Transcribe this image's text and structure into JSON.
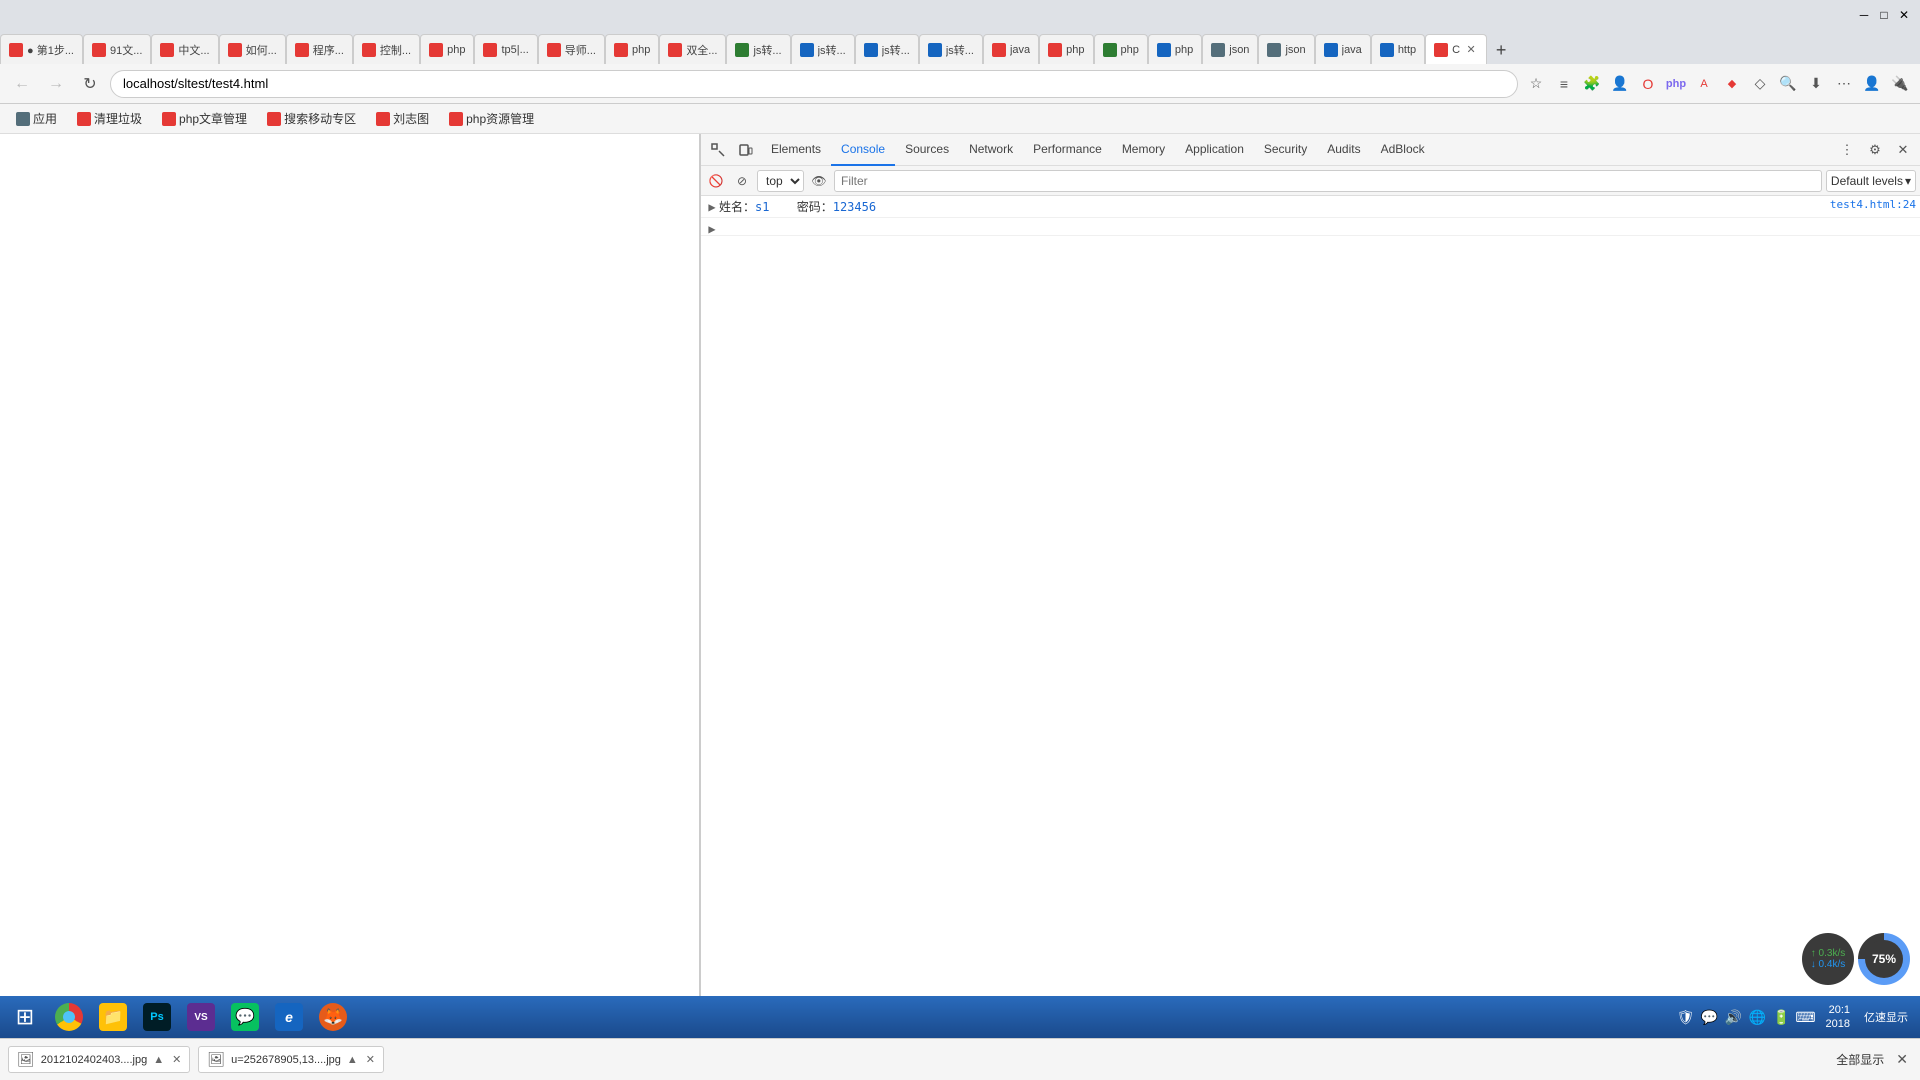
{
  "titleBar": {
    "minimizeLabel": "─",
    "maximizeLabel": "□",
    "closeLabel": "✕"
  },
  "tabs": [
    {
      "id": "tab-1",
      "favicon": "red",
      "label": "● 第1步..."
    },
    {
      "id": "tab-2",
      "favicon": "red",
      "label": "91文..."
    },
    {
      "id": "tab-3",
      "favicon": "red",
      "label": "中文..."
    },
    {
      "id": "tab-4",
      "favicon": "red",
      "label": "如何..."
    },
    {
      "id": "tab-5",
      "favicon": "red",
      "label": "程序..."
    },
    {
      "id": "tab-6",
      "favicon": "red",
      "label": "控制..."
    },
    {
      "id": "tab-7",
      "favicon": "red",
      "label": "php"
    },
    {
      "id": "tab-8",
      "favicon": "red",
      "label": "tp5|..."
    },
    {
      "id": "tab-9",
      "favicon": "red",
      "label": "导师..."
    },
    {
      "id": "tab-10",
      "favicon": "red",
      "label": "php"
    },
    {
      "id": "tab-11",
      "favicon": "red",
      "label": "双全..."
    },
    {
      "id": "tab-12",
      "favicon": "green",
      "label": "js转..."
    },
    {
      "id": "tab-13",
      "favicon": "blue",
      "label": "js转..."
    },
    {
      "id": "tab-14",
      "favicon": "blue",
      "label": "js转..."
    },
    {
      "id": "tab-15",
      "favicon": "blue",
      "label": "js转..."
    },
    {
      "id": "tab-16",
      "favicon": "red",
      "label": "java"
    },
    {
      "id": "tab-17",
      "favicon": "red",
      "label": "php"
    },
    {
      "id": "tab-18",
      "favicon": "green",
      "label": "php"
    },
    {
      "id": "tab-19",
      "favicon": "blue",
      "label": "php"
    },
    {
      "id": "tab-20",
      "favicon": "gray",
      "label": "json"
    },
    {
      "id": "tab-21",
      "favicon": "gray",
      "label": "json"
    },
    {
      "id": "tab-22",
      "favicon": "blue",
      "label": "java"
    },
    {
      "id": "tab-23",
      "favicon": "blue",
      "label": "http"
    },
    {
      "id": "tab-24",
      "favicon": "red",
      "label": "C",
      "active": true,
      "hasClose": true
    }
  ],
  "addressBar": {
    "url": "localhost/sltest/test4.html",
    "backEnabled": false,
    "forwardEnabled": false
  },
  "bookmarks": [
    {
      "label": "应用",
      "favicon": "gray"
    },
    {
      "label": "清理垃圾",
      "favicon": "red"
    },
    {
      "label": "php文章管理",
      "favicon": "red"
    },
    {
      "label": "搜索移动专区",
      "favicon": "red"
    },
    {
      "label": "刘志图",
      "favicon": "red"
    },
    {
      "label": "php资源管理",
      "favicon": "red"
    }
  ],
  "devtools": {
    "tabs": [
      {
        "label": "Elements",
        "active": false
      },
      {
        "label": "Console",
        "active": true
      },
      {
        "label": "Sources",
        "active": false
      },
      {
        "label": "Network",
        "active": false
      },
      {
        "label": "Performance",
        "active": false
      },
      {
        "label": "Memory",
        "active": false
      },
      {
        "label": "Application",
        "active": false
      },
      {
        "label": "Security",
        "active": false
      },
      {
        "label": "Audits",
        "active": false
      },
      {
        "label": "AdBlock",
        "active": false
      }
    ],
    "console": {
      "contextSelector": "top",
      "filterPlaceholder": "Filter",
      "levelsLabel": "Default levels",
      "output": [
        {
          "hasExpand": false,
          "message": "姓名：s1    密码：123456",
          "source": "test4.html:24",
          "isExpandable": true
        }
      ]
    }
  },
  "downloads": [
    {
      "icon": "🖼",
      "name": "2012102402403....jpg",
      "hasArrow": true
    },
    {
      "icon": "🖼",
      "name": "u=252678905,13....jpg",
      "hasArrow": true
    }
  ],
  "showAllLabel": "全部显示",
  "downloadCloseLabel": "✕",
  "performance": {
    "netUp": "0.3k/s",
    "netDown": "0.4k/s",
    "cpuPercent": "75%"
  },
  "taskbar": {
    "apps": [
      {
        "name": "start",
        "icon": "⊞",
        "color": "#1e88e5"
      },
      {
        "name": "chrome",
        "icon": "◉",
        "color": "#4CAF50"
      },
      {
        "name": "explorer",
        "icon": "📁",
        "color": "#FFC107"
      },
      {
        "name": "photoshop",
        "icon": "Ps",
        "color": "#001d26"
      },
      {
        "name": "visual-studio",
        "icon": "VS",
        "color": "#5c2d91"
      },
      {
        "name": "wechat",
        "icon": "💬",
        "color": "#07C160"
      },
      {
        "name": "ie",
        "icon": "e",
        "color": "#1565c0"
      },
      {
        "name": "firefox",
        "icon": "🦊",
        "color": "#e55b1a"
      }
    ],
    "tray": {
      "icons": [
        "🛡",
        "💬",
        "🔊",
        "🌐",
        "🔋",
        "⌨"
      ],
      "time": "20:1",
      "date": "2018"
    },
    "systemTray": "亿速显示"
  }
}
